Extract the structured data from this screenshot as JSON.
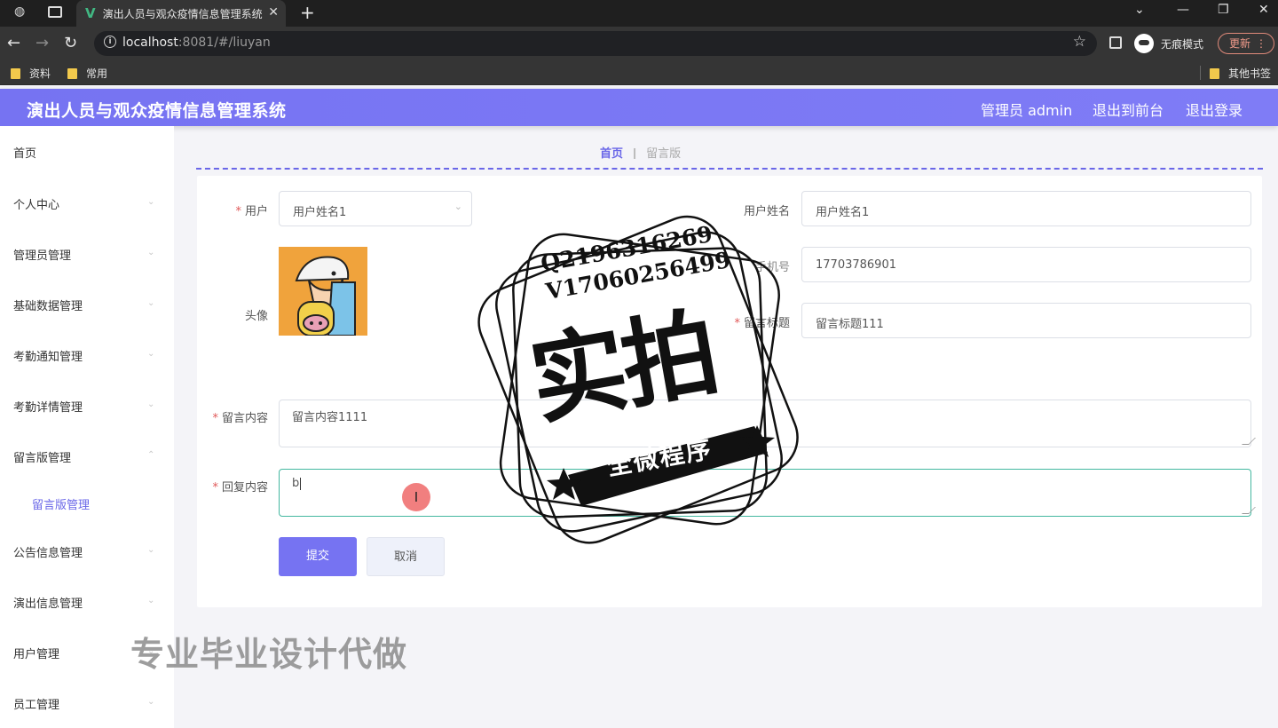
{
  "browser": {
    "tab_title": "演出人员与观众疫情信息管理系统",
    "tab_close": "✕",
    "new_tab": "+",
    "url_host": "localhost",
    "url_rest": ":8081/#/liuyan",
    "incognito_label": "无痕模式",
    "update_label": "更新",
    "bookmarks": [
      "资料",
      "常用"
    ],
    "other_bookmarks": "其他书签"
  },
  "header": {
    "title": "演出人员与观众疫情信息管理系统",
    "user_label": "管理员 admin",
    "to_front": "退出到前台",
    "logout": "退出登录"
  },
  "sidebar": {
    "items": [
      "首页",
      "个人中心",
      "管理员管理",
      "基础数据管理",
      "考勤通知管理",
      "考勤详情管理",
      "留言版管理",
      "公告信息管理",
      "演出信息管理",
      "用户管理",
      "员工管理"
    ],
    "active_sub": "留言版管理"
  },
  "breadcrumb": {
    "home": "首页",
    "current": "留言版"
  },
  "form": {
    "user_label": "用户",
    "user_value": "用户姓名1",
    "user_name_label": "用户姓名",
    "user_name_value": "用户姓名1",
    "avatar_label": "头像",
    "phone_label": "手机号",
    "phone_value": "17703786901",
    "title_label": "留言标题",
    "title_value": "留言标题111",
    "content_label": "留言内容",
    "content_value": "留言内容1111",
    "reply_label": "回复内容",
    "reply_value": "b",
    "submit": "提交",
    "cancel": "取消"
  },
  "overlay": {
    "contact_q": "Q2196316269",
    "contact_v": "V17060256499",
    "stamp_big": "实拍",
    "stamp_ribbon": "全微程序",
    "watermark": "专业毕业设计代做"
  },
  "colors": {
    "accent": "#7673f2",
    "required": "#e05858",
    "focus": "#44b8a0"
  }
}
